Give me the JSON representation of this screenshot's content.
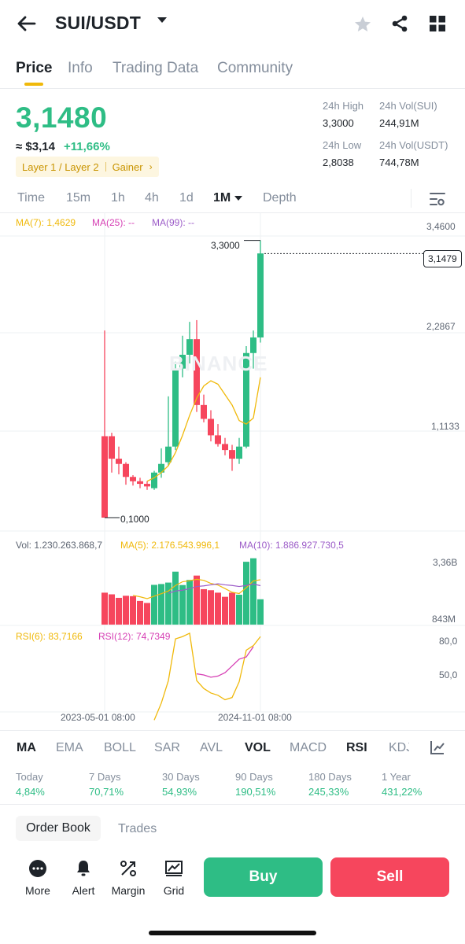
{
  "header": {
    "pair": "SUI/USDT",
    "icons": [
      "back-arrow-icon",
      "caret-down-icon",
      "star-icon",
      "share-icon",
      "grid-icon"
    ]
  },
  "tabs": [
    {
      "label": "Price",
      "active": true
    },
    {
      "label": "Info"
    },
    {
      "label": "Trading Data"
    },
    {
      "label": "Community"
    }
  ],
  "price": {
    "last": "3,1480",
    "usd": "≈ $3,14",
    "change": "+11,66%",
    "tag": "Layer 1 / Layer 2",
    "tag2": "Gainer",
    "high_label": "24h High",
    "high": "3,3000",
    "low_label": "24h Low",
    "low": "2,8038",
    "vol_base_label": "24h Vol(SUI)",
    "vol_base": "244,91M",
    "vol_quote_label": "24h Vol(USDT)",
    "vol_quote": "744,78M"
  },
  "intervals": [
    "Time",
    "15m",
    "1h",
    "4h",
    "1d",
    "1M",
    "Depth"
  ],
  "active_interval": "1M",
  "chart": {
    "ma7": "MA(7): 1,4629",
    "ma25": "MA(25): --",
    "ma99": "MA(99): --",
    "y_top": "3,4600",
    "y_mid": "2,2867",
    "y_low": "1,1133",
    "high_marker": "3,3000",
    "low_marker": "0,1000",
    "last_price_tag": "3,1479",
    "watermark": "BINANCE",
    "vol_text": "Vol: 1.230.263.868,7",
    "vol_ma5": "MA(5): 2.176.543.996,1",
    "vol_ma10": "MA(10): 1.886.927.730,5",
    "vol_top": "3,36B",
    "vol_bot": "843M",
    "rsi6": "RSI(6): 83,7166",
    "rsi12": "RSI(12): 74,7349",
    "rsi_top": "80,0",
    "rsi_mid": "50,0",
    "date1": "2023-05-01 08:00",
    "date2": "2024-11-01 08:00",
    "colors": {
      "up": "#2ebd85",
      "down": "#f6465d",
      "ma7": "#f0b90b",
      "ma25": "#d63fb4",
      "ma99": "#9c5cc8"
    }
  },
  "chart_data": {
    "type": "candlestick",
    "ylim": [
      0.1,
      3.46
    ],
    "candles": [
      {
        "o": 1.04,
        "h": 2.26,
        "l": 0.1,
        "c": 0.1
      },
      {
        "o": 1.04,
        "h": 1.08,
        "l": 0.62,
        "c": 0.78
      },
      {
        "o": 0.78,
        "h": 0.92,
        "l": 0.6,
        "c": 0.72
      },
      {
        "o": 0.72,
        "h": 0.74,
        "l": 0.48,
        "c": 0.57
      },
      {
        "o": 0.57,
        "h": 0.59,
        "l": 0.47,
        "c": 0.52
      },
      {
        "o": 0.52,
        "h": 0.56,
        "l": 0.44,
        "c": 0.49
      },
      {
        "o": 0.49,
        "h": 0.52,
        "l": 0.42,
        "c": 0.46
      },
      {
        "o": 0.44,
        "h": 0.64,
        "l": 0.42,
        "c": 0.62
      },
      {
        "o": 0.62,
        "h": 0.9,
        "l": 0.56,
        "c": 0.72
      },
      {
        "o": 0.74,
        "h": 1.5,
        "l": 0.7,
        "c": 0.92
      },
      {
        "o": 0.92,
        "h": 1.9,
        "l": 0.88,
        "c": 1.82
      },
      {
        "o": 1.82,
        "h": 2.2,
        "l": 1.72,
        "c": 1.98
      },
      {
        "o": 1.98,
        "h": 2.36,
        "l": 1.88,
        "c": 2.16
      },
      {
        "o": 2.16,
        "h": 2.38,
        "l": 1.32,
        "c": 1.4
      },
      {
        "o": 1.4,
        "h": 1.52,
        "l": 1.2,
        "c": 1.24
      },
      {
        "o": 1.24,
        "h": 1.34,
        "l": 0.98,
        "c": 1.05
      },
      {
        "o": 1.05,
        "h": 1.18,
        "l": 0.92,
        "c": 0.95
      },
      {
        "o": 0.95,
        "h": 1.02,
        "l": 0.82,
        "c": 0.88
      },
      {
        "o": 0.88,
        "h": 0.94,
        "l": 0.64,
        "c": 0.78
      },
      {
        "o": 0.78,
        "h": 1.02,
        "l": 0.72,
        "c": 0.92
      },
      {
        "o": 0.92,
        "h": 2.08,
        "l": 0.9,
        "c": 2.0
      },
      {
        "o": 2.0,
        "h": 2.26,
        "l": 1.82,
        "c": 2.18
      },
      {
        "o": 2.18,
        "h": 3.3,
        "l": 2.12,
        "c": 3.15
      }
    ],
    "ma7": [
      null,
      null,
      null,
      null,
      null,
      null,
      0.52,
      0.56,
      0.62,
      0.7,
      0.85,
      1.05,
      1.28,
      1.48,
      1.62,
      1.68,
      1.64,
      1.52,
      1.4,
      1.22,
      1.18,
      1.25,
      1.72
    ],
    "volume": [
      1.55,
      1.47,
      1.3,
      1.4,
      1.38,
      1.15,
      1.05,
      1.93,
      1.97,
      2.04,
      2.57,
      1.92,
      2.17,
      2.38,
      1.72,
      1.67,
      1.55,
      1.35,
      1.55,
      1.45,
      3.05,
      3.22,
      1.23
    ],
    "vol_ma5": [
      null,
      null,
      null,
      null,
      1.42,
      1.35,
      1.26,
      1.38,
      1.5,
      1.63,
      1.9,
      2.08,
      2.13,
      2.2,
      2.15,
      2.0,
      1.92,
      1.75,
      1.57,
      1.51,
      1.79,
      2.12,
      2.18
    ],
    "vol_ma10": [
      null,
      null,
      null,
      null,
      null,
      null,
      null,
      null,
      null,
      1.52,
      1.63,
      1.67,
      1.75,
      1.85,
      1.88,
      1.93,
      1.98,
      1.93,
      1.9,
      1.85,
      1.9,
      1.97,
      1.89
    ],
    "rsi6": [
      null,
      null,
      null,
      null,
      null,
      null,
      null,
      10,
      25,
      45,
      82,
      84,
      87,
      45,
      38,
      34,
      32,
      28,
      30,
      44,
      72,
      76,
      84
    ],
    "rsi12": [
      null,
      null,
      null,
      null,
      null,
      null,
      null,
      null,
      null,
      null,
      null,
      null,
      null,
      51,
      50,
      48,
      49,
      52,
      58,
      64,
      66,
      75
    ]
  },
  "indicators": [
    "MA",
    "EMA",
    "BOLL",
    "SAR",
    "AVL",
    "VOL",
    "MACD",
    "RSI",
    "KDJ"
  ],
  "active_indicators": [
    "MA",
    "VOL",
    "RSI"
  ],
  "periods": [
    {
      "label": "Today",
      "value": "4,84%"
    },
    {
      "label": "7 Days",
      "value": "70,71%"
    },
    {
      "label": "30 Days",
      "value": "54,93%"
    },
    {
      "label": "90 Days",
      "value": "190,51%"
    },
    {
      "label": "180 Days",
      "value": "245,33%"
    },
    {
      "label": "1 Year",
      "value": "431,22%"
    }
  ],
  "orderbook": {
    "tab1": "Order Book",
    "tab2": "Trades"
  },
  "actions": [
    {
      "label": "More",
      "icon": "more-icon"
    },
    {
      "label": "Alert",
      "icon": "bell-icon"
    },
    {
      "label": "Margin",
      "icon": "margin-icon"
    },
    {
      "label": "Grid",
      "icon": "grid-bot-icon"
    }
  ],
  "buy": "Buy",
  "sell": "Sell"
}
